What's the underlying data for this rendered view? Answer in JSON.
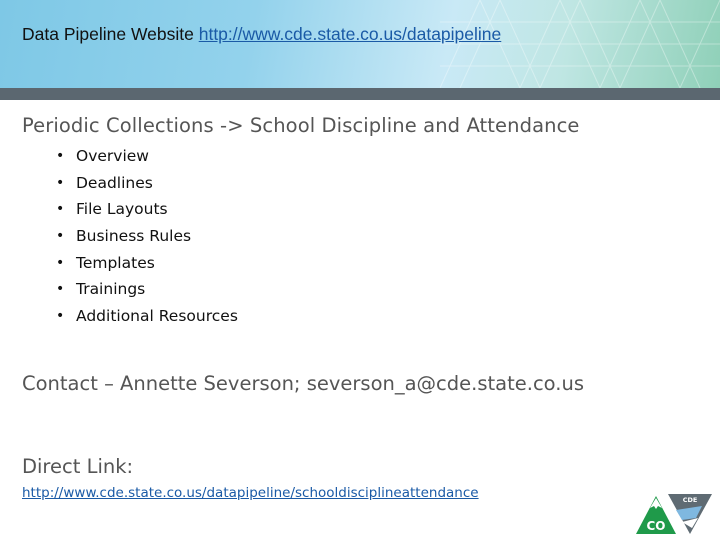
{
  "header": {
    "title_prefix": "Data Pipeline Website ",
    "title_link": "http://www.cde.state.co.us/datapipeline"
  },
  "heading": "Periodic Collections -> School Discipline and Attendance",
  "bullet_glyph": "•",
  "items": [
    {
      "label": "Overview"
    },
    {
      "label": "Deadlines"
    },
    {
      "label": "File Layouts"
    },
    {
      "label": "Business Rules"
    },
    {
      "label": "Templates"
    },
    {
      "label": "Trainings"
    },
    {
      "label": "Additional Resources"
    }
  ],
  "contact": "Contact – Annette Severson; severson_a@cde.state.co.us",
  "direct_label": "Direct Link:",
  "direct_url": "http://www.cde.state.co.us/datapipeline/schooldisciplineattendance",
  "logo": {
    "co_text": "CO",
    "cde_text": "CDE"
  },
  "colors": {
    "link": "#1a5aa6",
    "header_bar": "#5b6770",
    "logo_green": "#1f9a4a",
    "logo_gray": "#5f6b73"
  }
}
